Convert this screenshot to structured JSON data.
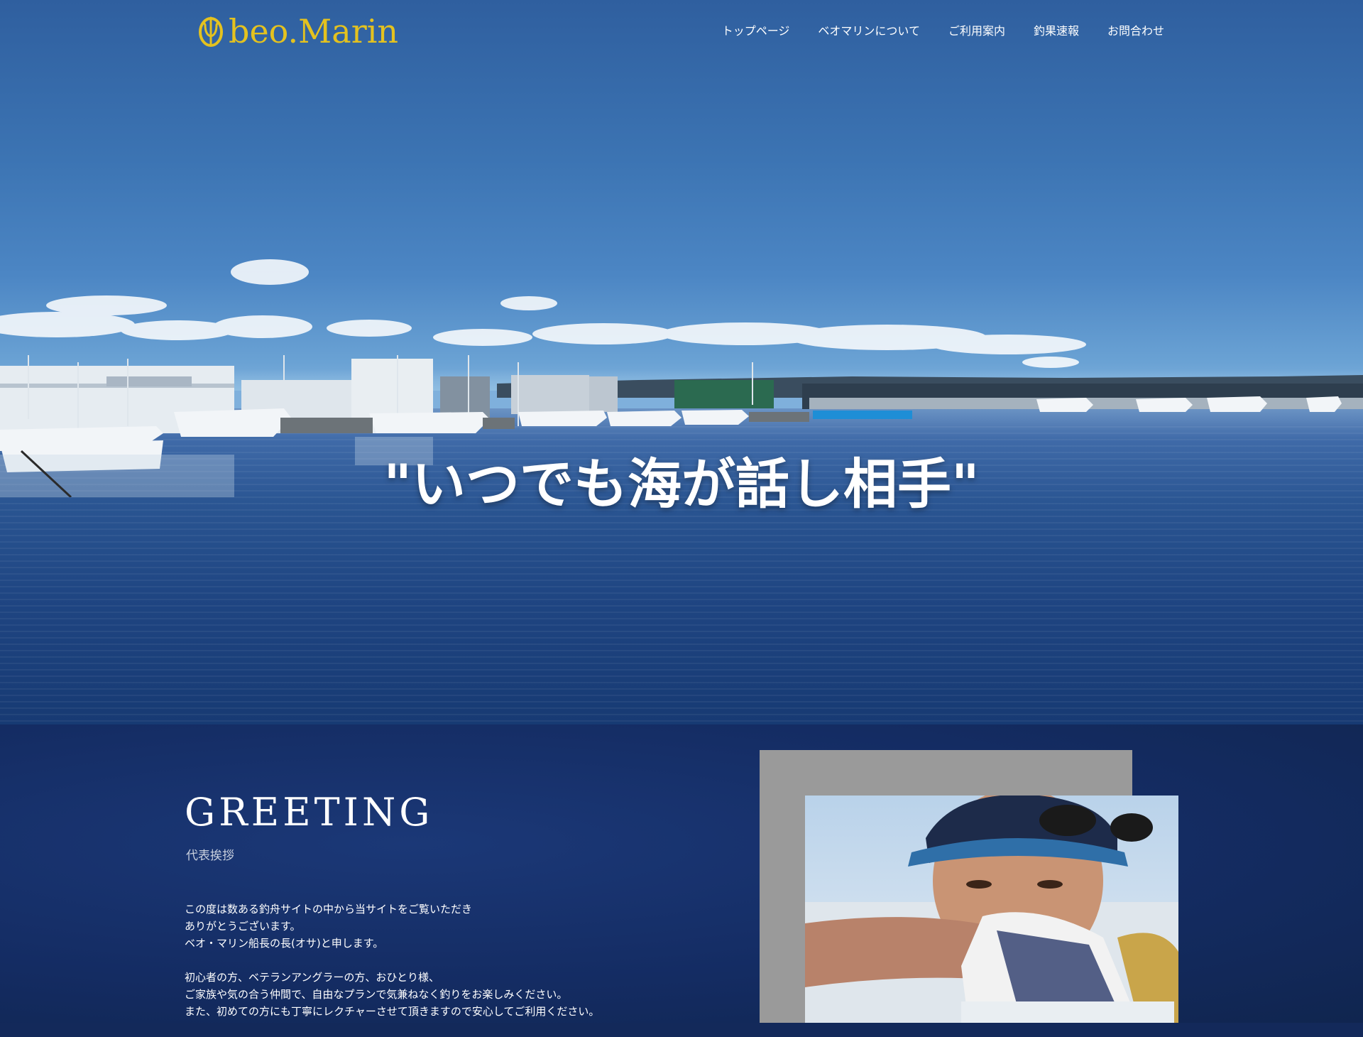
{
  "header": {
    "logo_text": "beo.Marin",
    "nav": [
      {
        "label": "トップページ"
      },
      {
        "label": "ベオマリンについて"
      },
      {
        "label": "ご利用案内"
      },
      {
        "label": "釣果速報"
      },
      {
        "label": "お問合わせ"
      }
    ]
  },
  "hero": {
    "catchcopy": "\"いつでも海が話し相手\""
  },
  "greeting": {
    "title": "GREETING",
    "subtitle": "代表挨拶",
    "paragraphs": [
      [
        "この度は数ある釣舟サイトの中から当サイトをご覧いただき",
        "ありがとうございます。",
        "ベオ・マリン船長の長(オサ)と申します。"
      ],
      [
        "初心者の方、ベテランアングラーの方、おひとり様、",
        "ご家族や気の合う仲間で、自由なプランで気兼ねなく釣りをお楽しみください。",
        "また、初めての方にも丁寧にレクチャーさせて頂きますので安心してご利用ください。"
      ]
    ]
  },
  "colors": {
    "logo": "#e4c21f",
    "greeting_bg": "#142c63",
    "photo_frame": "#9a9a9a"
  }
}
